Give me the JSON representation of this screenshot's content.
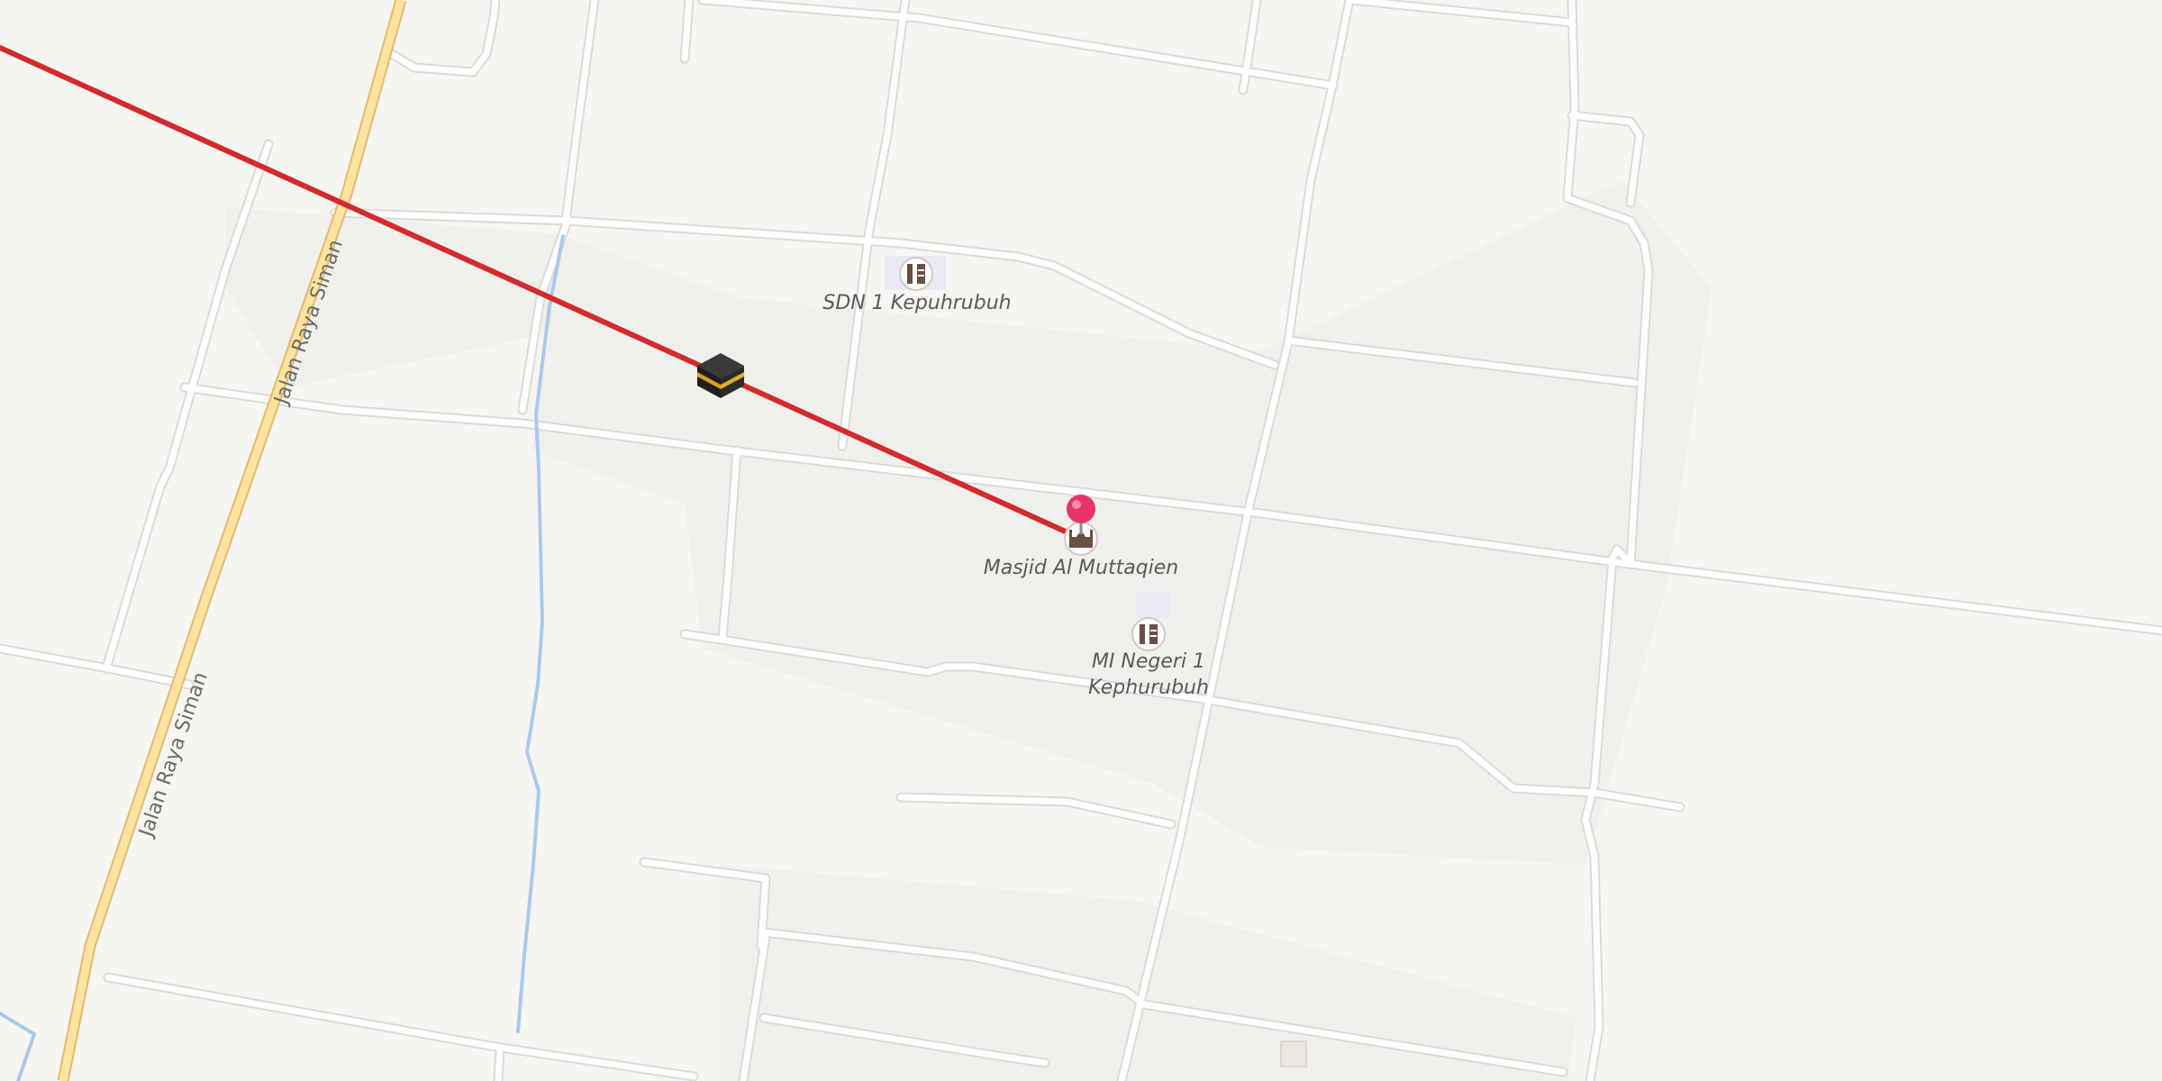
{
  "map": {
    "road_labels": {
      "upper": "Jalan Raya Siman",
      "lower": "Jalan Raya Siman"
    },
    "places": {
      "school_1": {
        "name": "SDN 1 Kepuhrubuh",
        "icon": "school-icon"
      },
      "mosque": {
        "name": "Masjid Al Muttaqien",
        "icon": "mosque-icon"
      },
      "school_2": {
        "name_line1": "MI Negeri 1",
        "name_line2": "Kephurubuh",
        "icon": "school-icon"
      }
    },
    "markers": {
      "kaaba": {
        "icon": "kaaba-icon"
      },
      "location_pin": {
        "icon": "pin-icon",
        "color": "#e8336d"
      }
    },
    "colors": {
      "background": "#f7f5f2",
      "block": "#f1efec",
      "road": "#ffffff",
      "road_edge": "#dddad6",
      "main_road": "#fde3a0",
      "main_road_edge": "#e7b86a",
      "water": "#a9c9ec",
      "qibla_line": "#d22b2b"
    }
  }
}
